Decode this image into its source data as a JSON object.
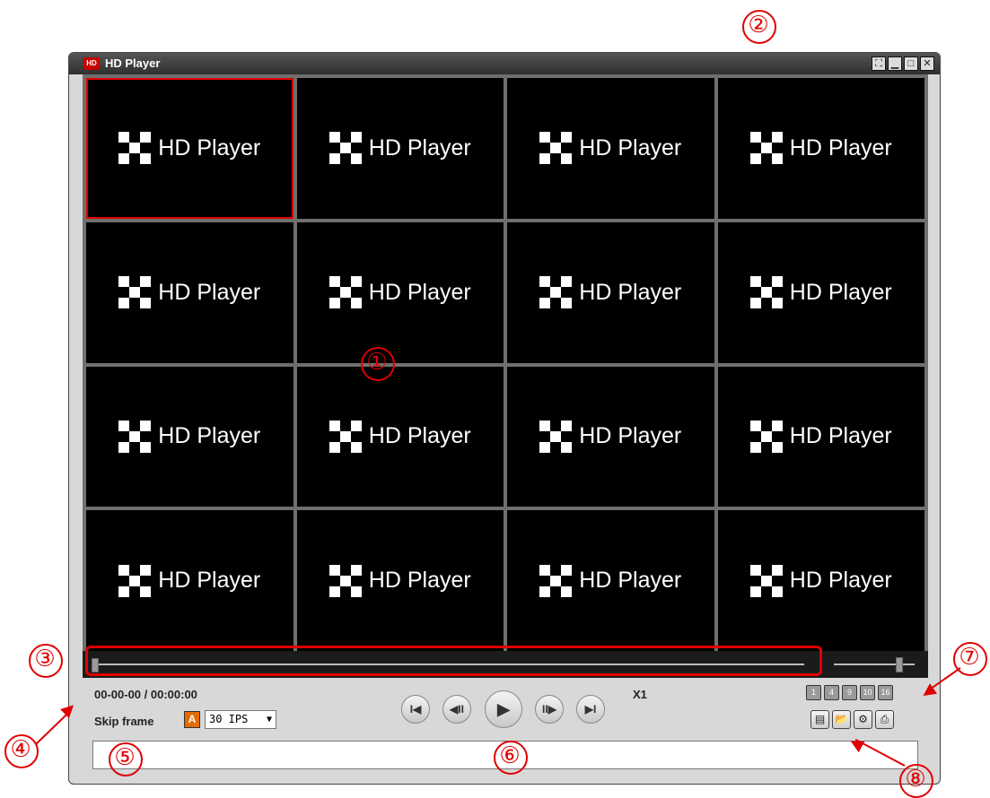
{
  "window": {
    "title": "HD Player",
    "app_icon_text": "HD",
    "buttons": [
      {
        "name": "fullscreen-button",
        "icon": "fullscreen-icon",
        "glyph": "⛶"
      },
      {
        "name": "minimize-button",
        "icon": "minimize-icon",
        "glyph": "▁"
      },
      {
        "name": "maximize-button",
        "icon": "maximize-icon",
        "glyph": "□"
      },
      {
        "name": "close-button",
        "icon": "close-icon",
        "glyph": "✕"
      }
    ]
  },
  "grid": {
    "rows": 4,
    "cols": 4,
    "selected_index": 0,
    "cell_logo_text": "HD Player"
  },
  "seek": {
    "position": 0.0,
    "volume": 0.8
  },
  "status": {
    "time": "00-00-00 / 00:00:00",
    "skip_label": "Skip frame",
    "auto_badge": "A",
    "fps_value": "30 IPS",
    "speed": "X1"
  },
  "playback_buttons": [
    {
      "name": "skip-to-start-button",
      "icon": "skip-to-start-icon",
      "glyph": "I◀"
    },
    {
      "name": "step-back-button",
      "icon": "step-back-icon",
      "glyph": "◀II"
    },
    {
      "name": "play-button",
      "icon": "play-icon",
      "glyph": "▶"
    },
    {
      "name": "step-forward-button",
      "icon": "step-forward-icon",
      "glyph": "II▶"
    },
    {
      "name": "skip-to-end-button",
      "icon": "skip-to-end-icon",
      "glyph": "▶I"
    }
  ],
  "split_buttons": [
    "1",
    "4",
    "9",
    "10",
    "16"
  ],
  "tool_buttons": [
    {
      "name": "backup-button",
      "icon": "monitor-icon",
      "glyph": "▤"
    },
    {
      "name": "open-file-button",
      "icon": "folder-open-icon",
      "glyph": "📂"
    },
    {
      "name": "settings-button",
      "icon": "gear-icon",
      "glyph": "⚙"
    },
    {
      "name": "print-button",
      "icon": "printer-icon",
      "glyph": "⎙"
    }
  ],
  "callouts": [
    "①",
    "②",
    "③",
    "④",
    "⑤",
    "⑥",
    "⑦",
    "⑧"
  ],
  "colors": {
    "accent": "#e00000",
    "badge": "#e56b00",
    "background": "#000000"
  }
}
